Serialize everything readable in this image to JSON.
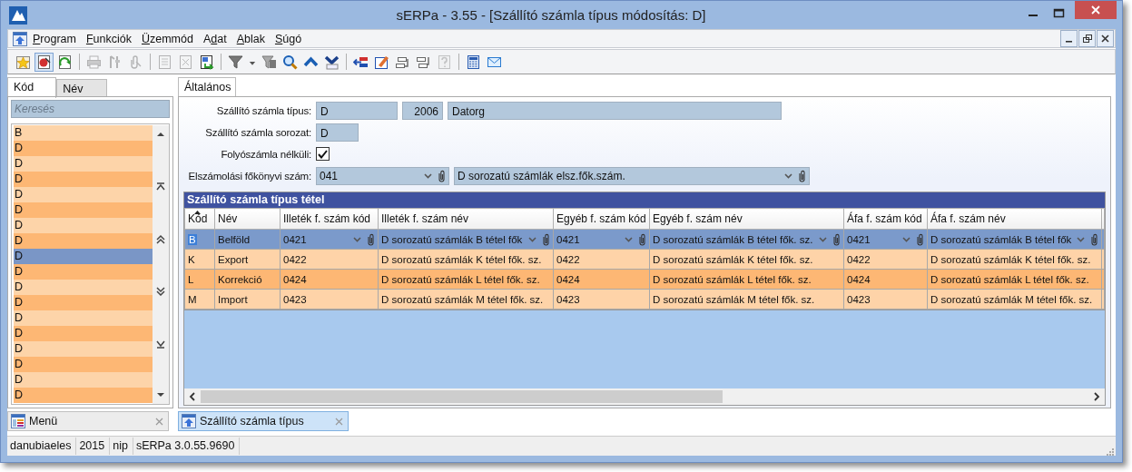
{
  "window": {
    "title": "sERPa - 3.55 - [Szállító számla típus módosítás: D]"
  },
  "menu": [
    {
      "key": "P",
      "rest": "rogram"
    },
    {
      "key": "F",
      "rest": "unkciók"
    },
    {
      "key": "Ü",
      "rest": "zemmód"
    },
    {
      "lead": "A",
      "key": "d",
      "rest": "at"
    },
    {
      "key": "A",
      "rest": "blak"
    },
    {
      "key": "S",
      "rest": "úgó"
    }
  ],
  "toolbar": [
    [
      {
        "kind": "favorite",
        "disabled": false,
        "pressed": false
      },
      {
        "kind": "record",
        "disabled": false,
        "pressed": true
      },
      {
        "kind": "refresh",
        "disabled": false,
        "pressed": false
      }
    ],
    [
      {
        "kind": "print",
        "disabled": true,
        "pressed": false
      },
      {
        "kind": "tools",
        "disabled": true,
        "pressed": false
      },
      {
        "kind": "attach",
        "disabled": true,
        "pressed": false
      }
    ],
    [
      {
        "kind": "doc",
        "disabled": true,
        "pressed": false
      },
      {
        "kind": "doc-delete",
        "disabled": true,
        "pressed": false
      },
      {
        "kind": "export",
        "disabled": false,
        "pressed": false
      }
    ],
    [
      {
        "kind": "filter",
        "disabled": false,
        "pressed": false
      },
      {
        "kind": "filter-menu",
        "disabled": false,
        "pressed": false
      },
      {
        "kind": "filter-clear",
        "disabled": false,
        "pressed": false
      },
      {
        "kind": "search",
        "disabled": false,
        "pressed": false
      },
      {
        "kind": "up",
        "disabled": false,
        "pressed": false
      },
      {
        "kind": "down",
        "disabled": false,
        "pressed": false
      }
    ],
    [
      {
        "kind": "insert",
        "disabled": false,
        "pressed": false
      },
      {
        "kind": "edit",
        "disabled": false,
        "pressed": false
      },
      {
        "kind": "move-left",
        "disabled": false,
        "pressed": false
      },
      {
        "kind": "move-right",
        "disabled": false,
        "pressed": false
      },
      {
        "kind": "help",
        "disabled": true,
        "pressed": false
      }
    ],
    [
      {
        "kind": "calculator",
        "disabled": false,
        "pressed": false
      },
      {
        "kind": "mail",
        "disabled": false,
        "pressed": false
      }
    ]
  ],
  "left_tabs": [
    {
      "label": "Kód",
      "selected": true
    },
    {
      "label": "Név",
      "selected": false
    }
  ],
  "search": {
    "placeholder": "Keresés"
  },
  "list": [
    {
      "label": "B",
      "selected": false
    },
    {
      "label": "D",
      "selected": false
    },
    {
      "label": "D",
      "selected": false
    },
    {
      "label": "D",
      "selected": false
    },
    {
      "label": "D",
      "selected": false
    },
    {
      "label": "D",
      "selected": false
    },
    {
      "label": "D",
      "selected": false
    },
    {
      "label": "D",
      "selected": false
    },
    {
      "label": "D",
      "selected": true
    },
    {
      "label": "D",
      "selected": false
    },
    {
      "label": "D",
      "selected": false
    },
    {
      "label": "D",
      "selected": false
    },
    {
      "label": "D",
      "selected": false
    },
    {
      "label": "D",
      "selected": false
    },
    {
      "label": "D",
      "selected": false
    },
    {
      "label": "D",
      "selected": false
    },
    {
      "label": "D",
      "selected": false
    },
    {
      "label": "D",
      "selected": false
    }
  ],
  "tabs": [
    {
      "label": "Általános",
      "selected": true
    }
  ],
  "form": {
    "type": {
      "label": "Szállító számla típus:",
      "code": "D",
      "year": "2006",
      "name": "Datorg"
    },
    "series": {
      "label": "Szállító számla sorozat:",
      "value": "D"
    },
    "no_current_account": {
      "label": "Folyószámla nélküli:",
      "checked": true
    },
    "ledger": {
      "label": "Elszámolási főkönyvi szám:",
      "code": "041",
      "name": "D sorozatú számlák elsz.fők.szám."
    }
  },
  "grid": {
    "title": "Szállító számla típus tétel",
    "columns": [
      {
        "label": "Kód",
        "lookup": false,
        "sorted": true
      },
      {
        "label": "Név",
        "lookup": false,
        "sorted": false
      },
      {
        "label": "Illeték f. szám kód",
        "lookup": true,
        "sorted": false
      },
      {
        "label": "Illeték f. szám név",
        "lookup": true,
        "sorted": false
      },
      {
        "label": "Egyéb f. szám kód",
        "lookup": true,
        "sorted": false
      },
      {
        "label": "Egyéb f. szám név",
        "lookup": true,
        "sorted": false
      },
      {
        "label": "Áfa f. szám kód",
        "lookup": true,
        "sorted": false
      },
      {
        "label": "Áfa f. szám név",
        "lookup": true,
        "sorted": false
      }
    ],
    "rows": [
      {
        "selected": true,
        "cells": [
          "B",
          "Belföld",
          "0421",
          "D sorozatú számlák B tétel fők",
          "0421",
          "D sorozatú számlák B tétel fők. sz.",
          "0421",
          "D sorozatú számlák B tétel fők"
        ]
      },
      {
        "selected": false,
        "cells": [
          "K",
          "Export",
          "0422",
          "D sorozatú számlák K tétel fők. sz.",
          "0422",
          "D sorozatú számlák K tétel fők. sz.",
          "0422",
          "D sorozatú számlák K tétel fők. sz."
        ]
      },
      {
        "selected": false,
        "cells": [
          "L",
          "Korrekció",
          "0424",
          "D sorozatú számlák L tétel fők. sz.",
          "0424",
          "D sorozatú számlák L tétel fők. sz.",
          "0424",
          "D sorozatú számlák L tétel fők. sz."
        ]
      },
      {
        "selected": false,
        "cells": [
          "M",
          "Import",
          "0423",
          "D sorozatú számlák M tétel fők. sz.",
          "0423",
          "D sorozatú számlák M tétel fők. sz.",
          "0423",
          "D sorozatú számlák M tétel fők. sz."
        ]
      }
    ]
  },
  "doc_tabs": [
    {
      "label": "Menü",
      "kind": "menu",
      "selected": false
    },
    {
      "label": "Szállító számla típus",
      "kind": "form",
      "selected": true
    }
  ],
  "status_bar": [
    "danubiaeles",
    "2015",
    "nip",
    "sERPa 3.0.55.9690"
  ]
}
